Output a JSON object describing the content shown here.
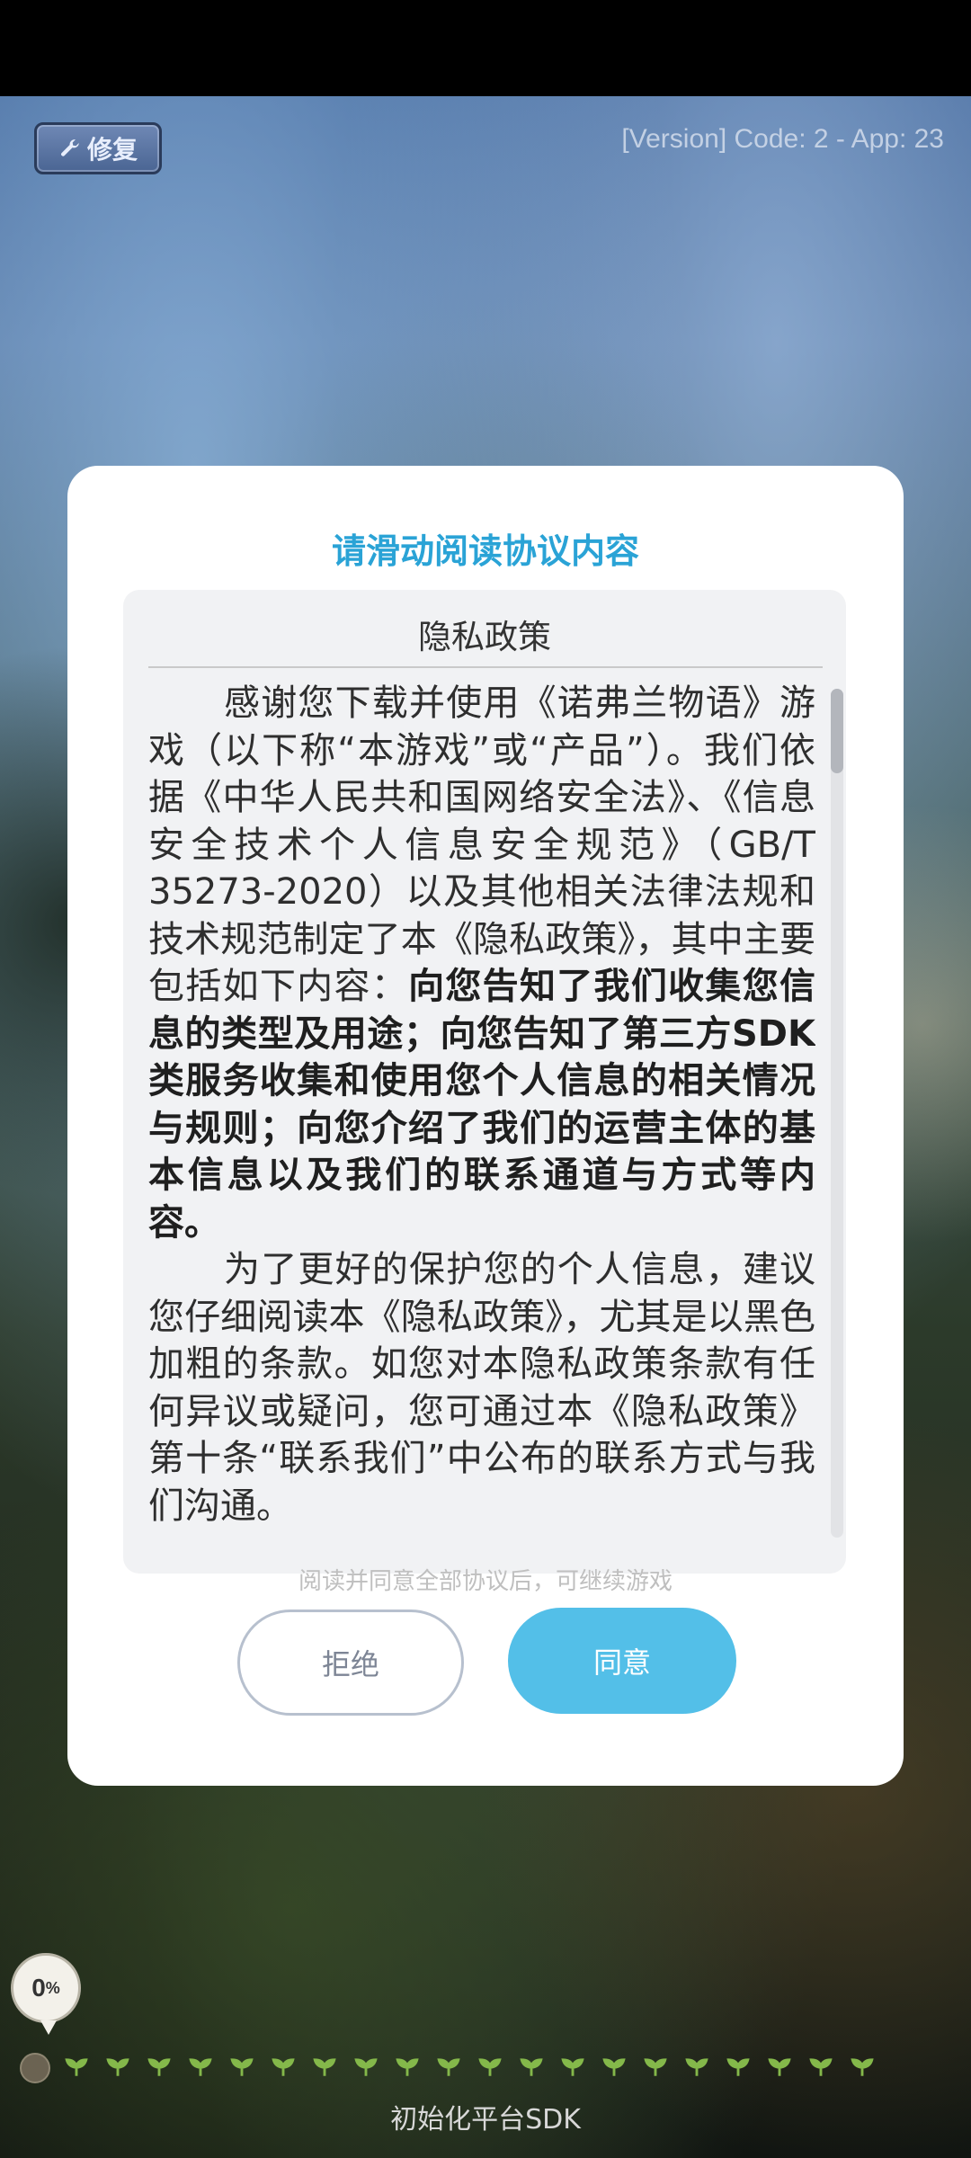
{
  "status_bar": {},
  "header": {
    "repair_label": "修复",
    "version_text": "[Version] Code: 2 - App: 23"
  },
  "dialog": {
    "title": "请滑动阅读协议内容",
    "policy_heading": "隐私政策",
    "paragraphs": [
      {
        "plain_1": "感谢您下载并使用《诺弗兰物语》游戏（以下称“本游戏”或“产品”）。我们依据《中华人民共和国网络安全法》、《信息安全技术个人信息安全规范》（GB/T 35273-2020）以及其他相关法律法规和技术规范制定了本《隐私政策》，其中主要包括如下内容：",
        "bold_1": "向您告知了我们收集您信息的类型及用途；向您告知了第三方SDK类服务收集和使用您个人信息的相关情况与规则；向您介绍了我们的运营主体的基本信息以及我们的联系通道与方式等内容。"
      },
      {
        "plain_1": "为了更好的保护您的个人信息，建议您仔细阅读本《隐私政策》，尤其是以黑色加粗的条款。如您对本隐私政策条款有任何异议或疑问，您可通过本《隐私政策》第十条“联系我们”中公布的联系方式与我们沟通。"
      }
    ],
    "hint": "阅读并同意全部协议后，可继续游戏",
    "reject_label": "拒绝",
    "agree_label": "同意"
  },
  "loading": {
    "progress_value": "0",
    "progress_unit": "%",
    "sprout_count_icon": "sprout-icon",
    "footer_label": "初始化平台SDK"
  },
  "colors": {
    "accent": "#2aa3d6",
    "agree_button": "#53bfe8",
    "sprout": "#84b84a"
  }
}
